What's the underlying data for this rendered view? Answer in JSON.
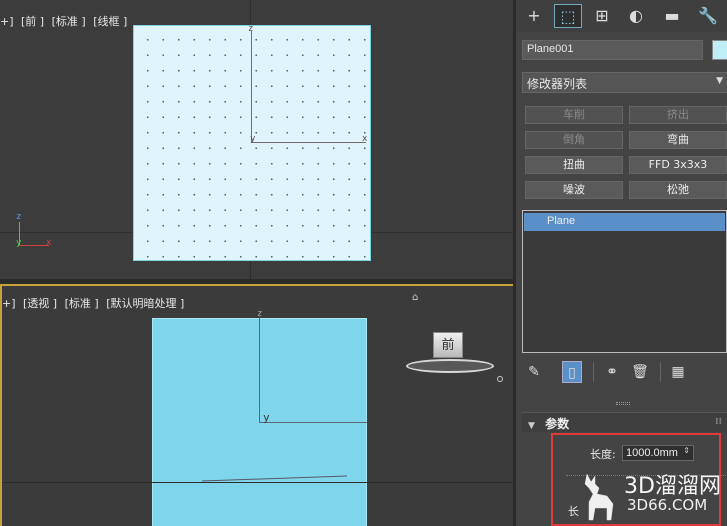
{
  "viewport_top": {
    "label_items": [
      "+]",
      "[前 ]",
      "[标准 ]",
      "[线框 ]"
    ],
    "axis_z": "z",
    "axis_y": "y",
    "axis_x": "x",
    "gizmo_z": "z",
    "gizmo_y": "y",
    "gizmo_x": "x"
  },
  "viewport_persp": {
    "label_items": [
      "+]",
      "[透视 ]",
      "[标准 ]",
      "[默认明暗处理 ]"
    ],
    "axis_z": "z",
    "axis_y": "y",
    "viewcube_face": "前"
  },
  "panel": {
    "tabs": [
      {
        "icon": "create-icon",
        "glyph": "+"
      },
      {
        "icon": "modify-icon",
        "glyph": "⬚"
      },
      {
        "icon": "hierarchy-icon",
        "glyph": "⊞"
      },
      {
        "icon": "motion-icon",
        "glyph": "◐"
      },
      {
        "icon": "display-icon",
        "glyph": "▬"
      },
      {
        "icon": "utilities-icon",
        "glyph": "🔧"
      }
    ],
    "object_name": "Plane001",
    "object_color": "#bfeef6",
    "modifier_list": "修改器列表",
    "modifier_buttons": [
      {
        "label": "车削",
        "enabled": false
      },
      {
        "label": "挤出",
        "enabled": false
      },
      {
        "label": "倒角",
        "enabled": false
      },
      {
        "label": "弯曲",
        "enabled": true
      },
      {
        "label": "扭曲",
        "enabled": true
      },
      {
        "label": "FFD 3x3x3",
        "enabled": true
      },
      {
        "label": "噪波",
        "enabled": true
      },
      {
        "label": "松弛",
        "enabled": true
      }
    ],
    "stack_items": [
      "Plane"
    ],
    "rollout_title": "参数",
    "params": {
      "length_label": "长度:",
      "length_value": "1000.0mm",
      "length2_label": "长"
    }
  },
  "watermark": {
    "brand": "3D溜溜网",
    "domain": "3D66.COM"
  },
  "colors": {
    "accent": "#5b8fc7",
    "highlight_box": "#e03a3a",
    "active_viewport": "#c5a23a",
    "plane": "#7fd6ec"
  }
}
